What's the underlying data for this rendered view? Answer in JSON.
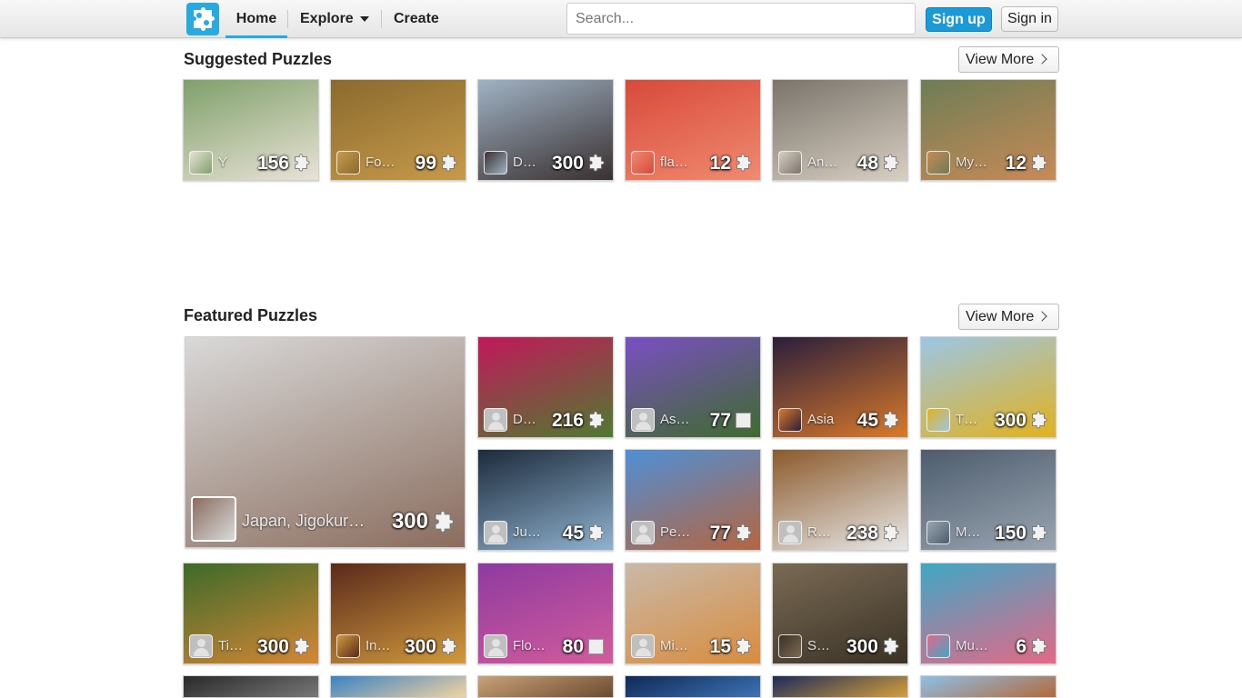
{
  "header": {
    "nav": {
      "home": "Home",
      "explore": "Explore",
      "create": "Create"
    },
    "search_placeholder": "Search...",
    "signup": "Sign up",
    "signin": "Sign in"
  },
  "suggested": {
    "title": "Suggested Puzzles",
    "view_more": "View More",
    "tiles": [
      {
        "name": "Y",
        "count": "156",
        "colors": [
          "#7fa06a",
          "#e9e2d6"
        ]
      },
      {
        "name": "For…",
        "count": "99",
        "colors": [
          "#8a6a2e",
          "#c79a4a"
        ]
      },
      {
        "name": "D…",
        "count": "300",
        "colors": [
          "#9fb2c4",
          "#3a3030"
        ]
      },
      {
        "name": "fla…",
        "count": "12",
        "colors": [
          "#d84a3a",
          "#f08a70"
        ]
      },
      {
        "name": "Ani…",
        "count": "48",
        "colors": [
          "#7b746b",
          "#d7cfc2"
        ]
      },
      {
        "name": "My…",
        "count": "12",
        "colors": [
          "#6e7d55",
          "#c88a57"
        ]
      }
    ]
  },
  "featured": {
    "title": "Featured Puzzles",
    "view_more": "View More",
    "big": {
      "name": "Japan, Jigokur…",
      "count": "300",
      "colors": [
        "#d9d9d9",
        "#8a6d5e"
      ]
    },
    "tiles": [
      {
        "name": "D…",
        "count": "216",
        "colors": [
          "#c2185b",
          "#4f7a2f"
        ]
      },
      {
        "name": "Ast…",
        "count": "77",
        "colors": [
          "#7a4fc3",
          "#3f6b2e"
        ]
      },
      {
        "name": "Asia",
        "count": "45",
        "colors": [
          "#2b1e3c",
          "#d97a2a"
        ]
      },
      {
        "name": "T…",
        "count": "300",
        "colors": [
          "#9cc6e6",
          "#e2b21c"
        ]
      },
      {
        "name": "Jus…",
        "count": "45",
        "colors": [
          "#1d2b3c",
          "#8fb2cf"
        ]
      },
      {
        "name": "Pe…",
        "count": "77",
        "colors": [
          "#4f8fd6",
          "#b5653f"
        ]
      },
      {
        "name": "R…",
        "count": "238",
        "colors": [
          "#8b5a2b",
          "#e8e8e8"
        ]
      },
      {
        "name": "M…",
        "count": "150",
        "colors": [
          "#4d5d6e",
          "#9aa5b1"
        ]
      },
      {
        "name": "Ti…",
        "count": "300",
        "colors": [
          "#3d6a2a",
          "#d48735"
        ]
      },
      {
        "name": "In…",
        "count": "300",
        "colors": [
          "#5a2a1c",
          "#d19a3c"
        ]
      },
      {
        "name": "Flo…",
        "count": "80",
        "colors": [
          "#8e3aa0",
          "#d25c9c"
        ]
      },
      {
        "name": "Mic…",
        "count": "15",
        "colors": [
          "#c9b9a8",
          "#d88c3e"
        ]
      },
      {
        "name": "S…",
        "count": "300",
        "colors": [
          "#7a6a54",
          "#3a3226"
        ]
      },
      {
        "name": "Musi…",
        "count": "6",
        "colors": [
          "#3ea8c6",
          "#e56886"
        ]
      }
    ],
    "partial_row": [
      {
        "colors": [
          "#2a2a2a",
          "#777777"
        ]
      },
      {
        "colors": [
          "#3b82c4",
          "#f2d3a0"
        ]
      },
      {
        "colors": [
          "#c9a27a",
          "#6b4a2e"
        ]
      },
      {
        "colors": [
          "#0f2a56",
          "#3d73b5"
        ]
      },
      {
        "colors": [
          "#1c2b5a",
          "#d6a03a"
        ]
      },
      {
        "colors": [
          "#8cc0e6",
          "#b5693a"
        ]
      }
    ]
  }
}
